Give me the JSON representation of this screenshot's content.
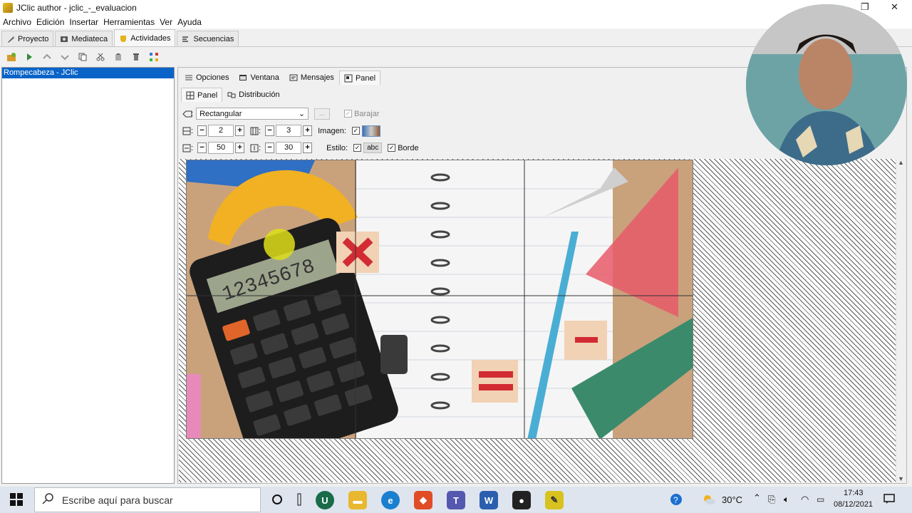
{
  "window": {
    "title": "JClic author - jclic_-_evaluacion"
  },
  "menu": [
    "Archivo",
    "Edición",
    "Insertar",
    "Herramientas",
    "Ver",
    "Ayuda"
  ],
  "main_tabs": [
    {
      "label": "Proyecto",
      "icon": "wrench-icon"
    },
    {
      "label": "Mediateca",
      "icon": "media-icon"
    },
    {
      "label": "Actividades",
      "icon": "activity-icon",
      "active": true
    },
    {
      "label": "Secuencias",
      "icon": "sequence-icon"
    }
  ],
  "left_panel": {
    "selected_item": "Rompecabeza - JClic"
  },
  "sub_tabs": [
    {
      "label": "Opciones",
      "icon": "options-icon"
    },
    {
      "label": "Ventana",
      "icon": "window-icon"
    },
    {
      "label": "Mensajes",
      "icon": "messages-icon"
    },
    {
      "label": "Panel",
      "icon": "panel-icon",
      "active": true
    }
  ],
  "panel_tabs": [
    {
      "label": "Panel",
      "icon": "grid-icon",
      "active": true
    },
    {
      "label": "Distribución",
      "icon": "layout-icon"
    }
  ],
  "shape": {
    "label": ":",
    "value": "Rectangular",
    "dots_label": "...",
    "shuffle_label": "Barajar",
    "shuffle_checked": true
  },
  "grid": {
    "rows_label": ":",
    "rows": "2",
    "cols_label": ":",
    "cols": "3",
    "image_label": "Imagen:"
  },
  "cell_size": {
    "width_label": ":",
    "width": "50",
    "height_label": ":",
    "height": "30",
    "style_label": "Estilo:",
    "style_sample": "abc",
    "border_label": "Borde",
    "border_checked": true
  },
  "calculator_display": "12345678",
  "taskbar": {
    "search_placeholder": "Escribe aquí para buscar",
    "temperature": "30°C",
    "time": "17:43",
    "date": "08/12/2021"
  }
}
